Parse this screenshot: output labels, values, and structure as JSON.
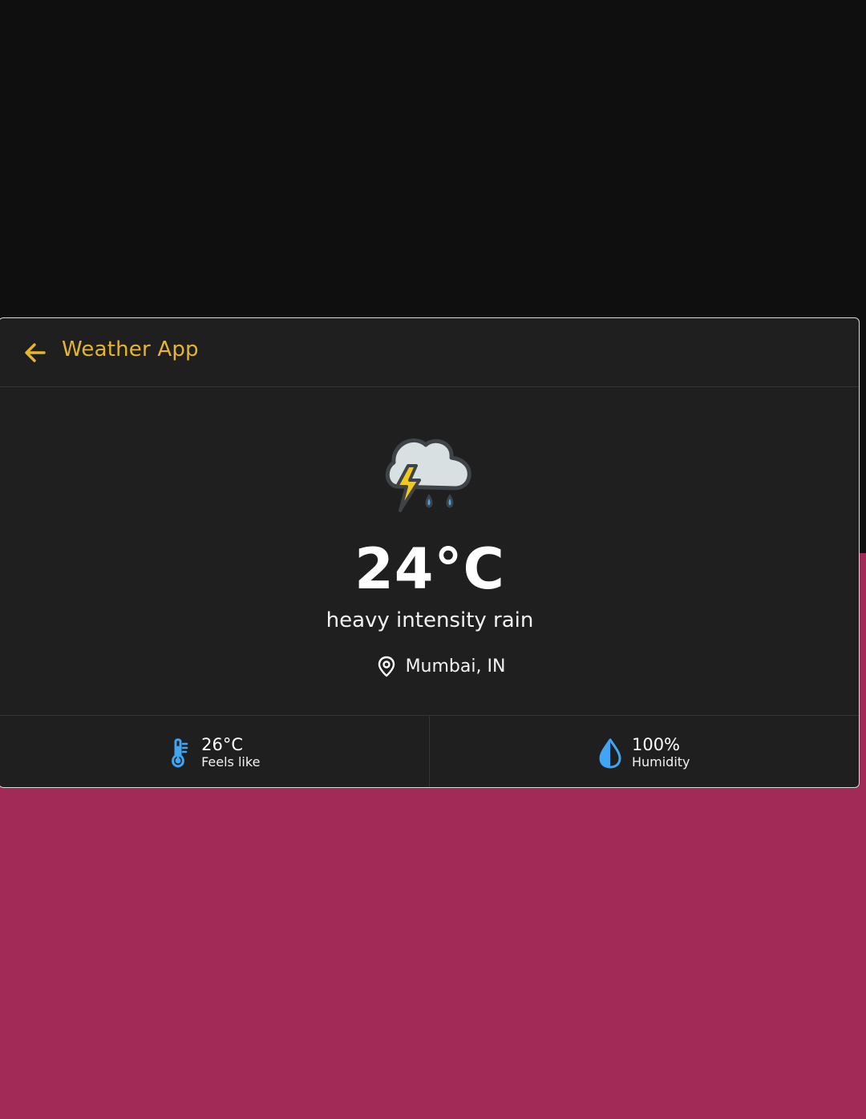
{
  "colors": {
    "page_top": "#0f0f10",
    "page_bottom": "#a22a56",
    "card_bg": "#1f1f1f",
    "accent": "#e6b52e",
    "icon_blue": "#3ea6f2"
  },
  "header": {
    "back_icon": "arrow-left-icon",
    "title": "Weather App"
  },
  "weather": {
    "icon": "thunderstorm-rain-icon",
    "temperature": "24°C",
    "description": "heavy intensity rain",
    "location_icon": "map-pin-icon",
    "location": "Mumbai, IN"
  },
  "stats": [
    {
      "icon": "thermometer-icon",
      "value": "26°C",
      "label": "Feels like"
    },
    {
      "icon": "water-drop-icon",
      "value": "100%",
      "label": "Humidity"
    }
  ]
}
